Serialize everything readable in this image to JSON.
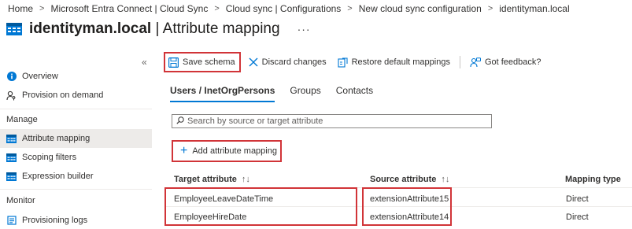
{
  "breadcrumb": [
    "Home",
    "Microsoft Entra Connect | Cloud Sync",
    "Cloud sync | Configurations",
    "New cloud sync configuration",
    "identityman.local"
  ],
  "breadcrumb_separator": ">",
  "header": {
    "title_bold": "identityman.local",
    "title_rest": " | Attribute mapping",
    "more_label": "···",
    "icon": "table-icon"
  },
  "sidebar": {
    "collapse_label": "«",
    "items": [
      {
        "label": "Overview",
        "icon": "info-icon"
      },
      {
        "label": "Provision on demand",
        "icon": "person-key-icon"
      }
    ],
    "manage_heading": "Manage",
    "manage_items": [
      {
        "label": "Attribute mapping",
        "icon": "table-icon",
        "active": true
      },
      {
        "label": "Scoping filters",
        "icon": "table-icon"
      },
      {
        "label": "Expression builder",
        "icon": "table-icon"
      }
    ],
    "monitor_heading": "Monitor",
    "monitor_items": [
      {
        "label": "Provisioning logs",
        "icon": "log-icon"
      }
    ]
  },
  "toolbar": {
    "save_label": "Save schema",
    "discard_label": "Discard changes",
    "restore_label": "Restore default mappings",
    "feedback_label": "Got feedback?"
  },
  "tabs": [
    {
      "label": "Users / InetOrgPersons",
      "active": true
    },
    {
      "label": "Groups",
      "active": false
    },
    {
      "label": "Contacts",
      "active": false
    }
  ],
  "search": {
    "placeholder": "Search by source or target attribute",
    "value": ""
  },
  "add_mapping_label": "Add attribute mapping",
  "table": {
    "columns": [
      "Target attribute",
      "Source attribute",
      "Mapping type"
    ],
    "sort_glyph": "↑↓",
    "rows": [
      {
        "target": "EmployeeLeaveDateTime",
        "source": "extensionAttribute15",
        "type": "Direct"
      },
      {
        "target": "EmployeeHireDate",
        "source": "extensionAttribute14",
        "type": "Direct"
      }
    ]
  },
  "colors": {
    "accent": "#0078d4",
    "highlight": "#d13438",
    "active_nav": "#edebe9"
  }
}
